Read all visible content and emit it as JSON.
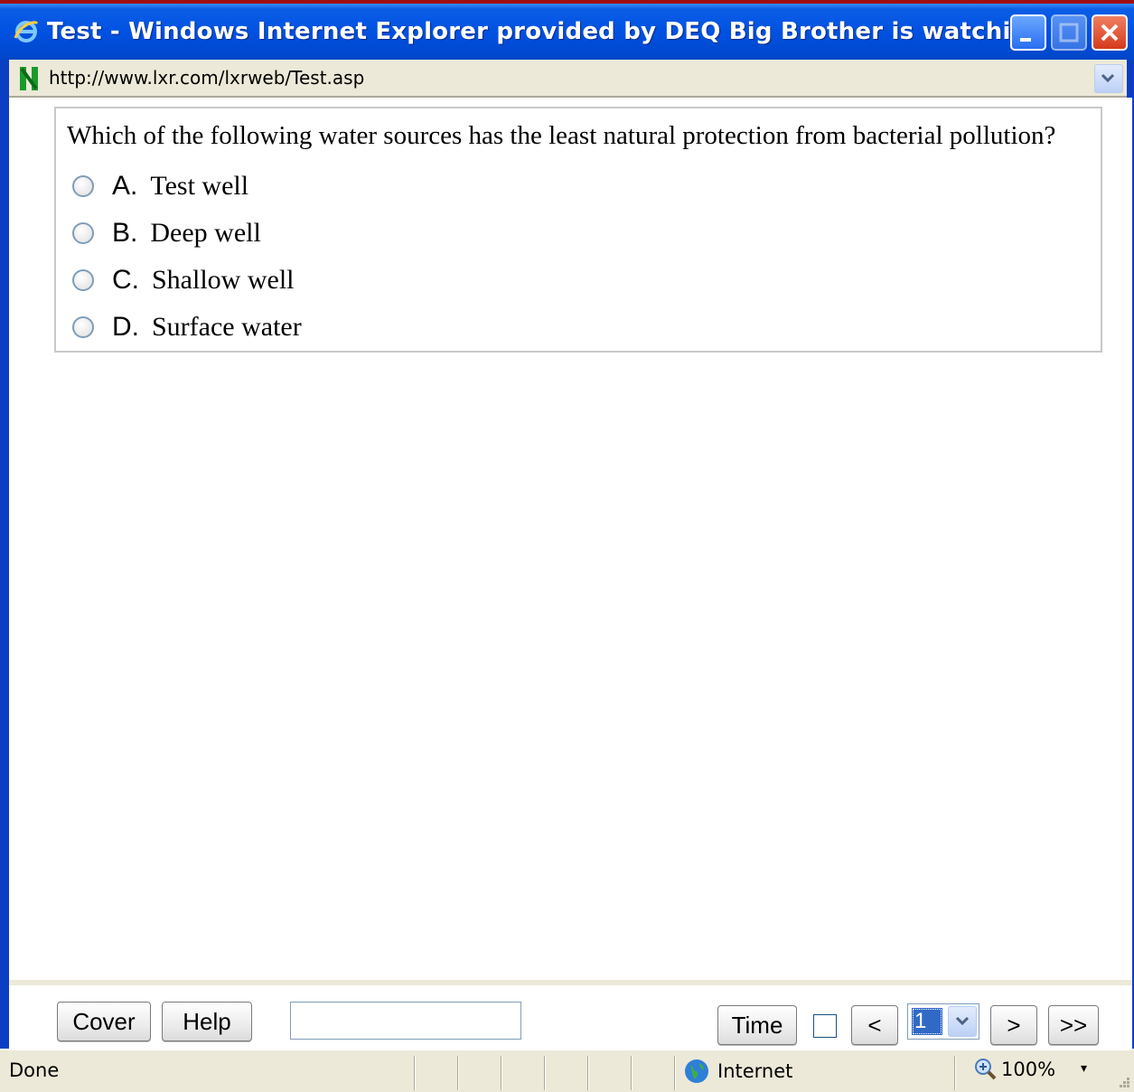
{
  "window": {
    "title": "Test - Windows Internet Explorer provided by DEQ Big Brother is watching",
    "icon": "ie-icon",
    "controls": [
      "minimize-icon",
      "maximize-icon",
      "close-icon"
    ]
  },
  "address": {
    "url": "http://www.lxr.com/lxrweb/Test.asp",
    "icon": "site-icon"
  },
  "question": {
    "text": "Which of the following water sources has the least natural protection from bacterial pollution?",
    "options": [
      {
        "letter": "A.",
        "text": "Test well",
        "selected": false
      },
      {
        "letter": "B.",
        "text": "Deep well",
        "selected": false
      },
      {
        "letter": "C.",
        "text": "Shallow well",
        "selected": false
      },
      {
        "letter": "D.",
        "text": "Surface water",
        "selected": false
      }
    ]
  },
  "toolbar": {
    "cover_label": "Cover",
    "help_label": "Help",
    "text_value": "",
    "time_label": "Time",
    "time_checked": false,
    "prev_label": "<",
    "page_value": "1",
    "next_label": ">",
    "last_label": ">>"
  },
  "status": {
    "text": "Done",
    "zone": "Internet",
    "zoom": "100%"
  },
  "colors": {
    "titlebar": "#0050e0",
    "frame": "#0a3fc4",
    "chrome": "#ece9d8",
    "selection": "#316ac5"
  }
}
